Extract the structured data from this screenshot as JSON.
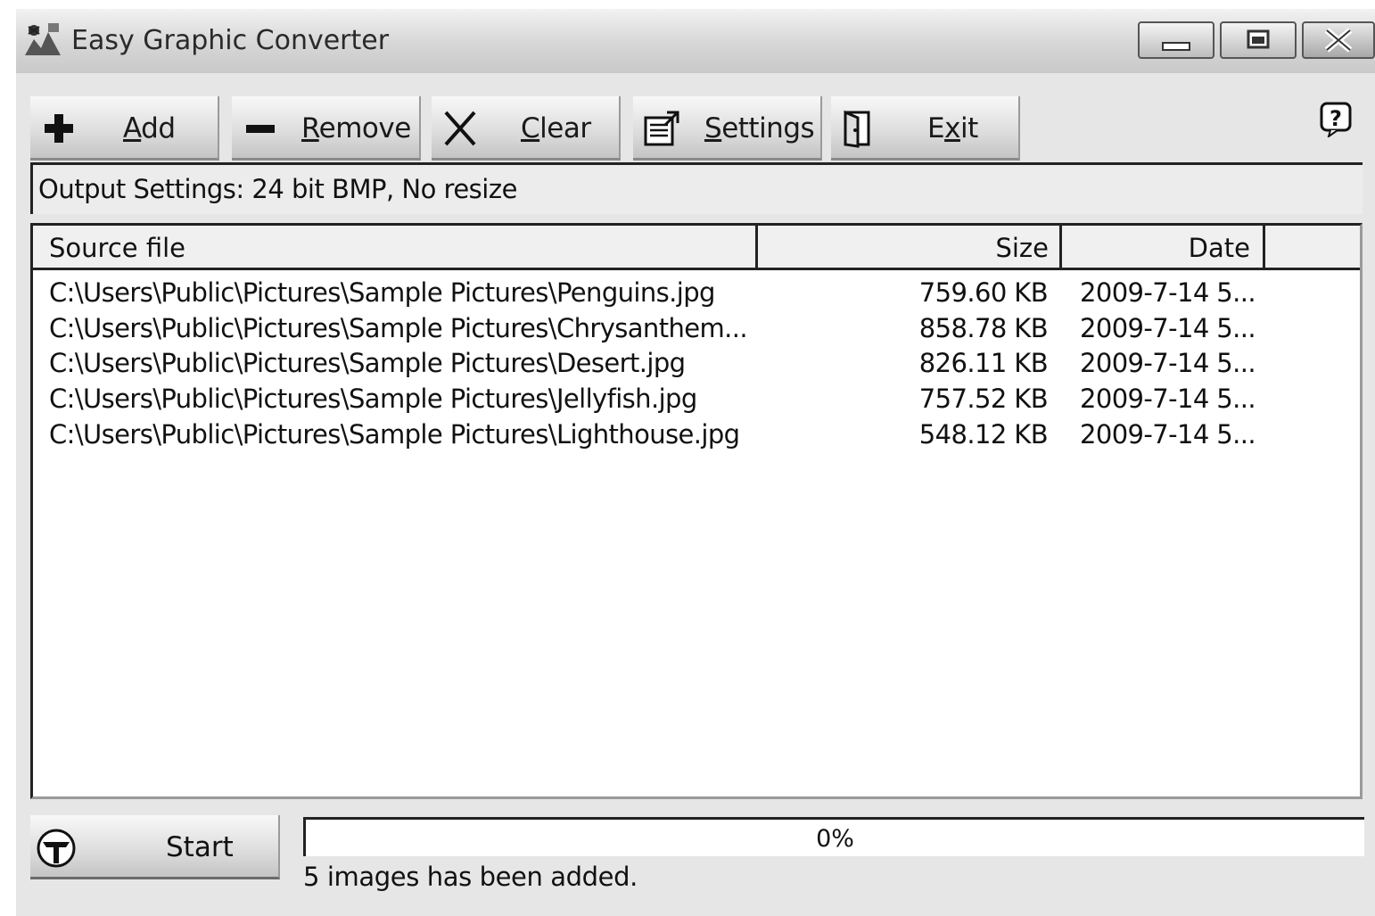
{
  "window": {
    "title": "Easy Graphic Converter",
    "controls": {
      "minimize": "minimize-icon",
      "maximize": "maximize-icon",
      "close": "close-icon"
    }
  },
  "toolbar": {
    "add": {
      "mnemonic": "A",
      "rest": "dd",
      "icon": "plus-icon"
    },
    "remove": {
      "mnemonic": "R",
      "rest": "emove",
      "icon": "minus-icon"
    },
    "clear": {
      "mnemonic": "C",
      "rest": "lear",
      "icon": "x-icon"
    },
    "settings": {
      "mnemonic": "S",
      "rest": "ettings",
      "icon": "settings-icon"
    },
    "exit": {
      "before": "E",
      "mnemonic": "x",
      "rest": "it",
      "icon": "door-icon"
    },
    "help": {
      "label": "?",
      "icon": "help-icon"
    }
  },
  "output_settings": "Output Settings: 24 bit BMP, No resize",
  "list": {
    "columns": {
      "source": "Source file",
      "size": "Size",
      "date": "Date"
    },
    "rows": [
      {
        "file": "C:\\Users\\Public\\Pictures\\Sample Pictures\\Penguins.jpg",
        "size": "759.60 KB",
        "date": "2009-7-14 5..."
      },
      {
        "file": "C:\\Users\\Public\\Pictures\\Sample Pictures\\Chrysanthem...",
        "size": "858.78 KB",
        "date": "2009-7-14 5..."
      },
      {
        "file": "C:\\Users\\Public\\Pictures\\Sample Pictures\\Desert.jpg",
        "size": "826.11 KB",
        "date": "2009-7-14 5..."
      },
      {
        "file": "C:\\Users\\Public\\Pictures\\Sample Pictures\\Jellyfish.jpg",
        "size": "757.52 KB",
        "date": "2009-7-14 5..."
      },
      {
        "file": "C:\\Users\\Public\\Pictures\\Sample Pictures\\Lighthouse.jpg",
        "size": "548.12 KB",
        "date": "2009-7-14 5..."
      }
    ]
  },
  "start_button": {
    "label": "Start",
    "icon": "start-icon"
  },
  "progress": {
    "value": 0,
    "text": "0%"
  },
  "status": "5 images has been added."
}
